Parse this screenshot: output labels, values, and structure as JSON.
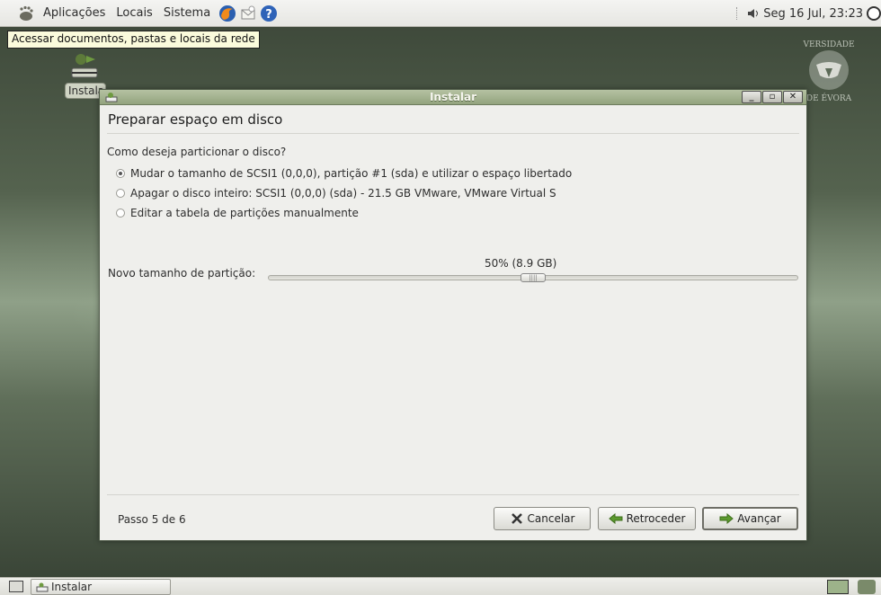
{
  "top_panel": {
    "menus": [
      "Aplicações",
      "Locais",
      "Sistema"
    ],
    "clock": "Seg 16 Jul, 23:23"
  },
  "tooltip": "Acessar documentos, pastas e locais da rede",
  "desktop_icon": {
    "label": "Instalar"
  },
  "window": {
    "title": "Instalar",
    "heading": "Preparar espaço em disco",
    "question": "Como deseja particionar o disco?",
    "options": [
      {
        "label": "Mudar o tamanho de SCSI1 (0,0,0), partição #1 (sda) e utilizar o espaço libertado",
        "selected": true
      },
      {
        "label": "Apagar o disco inteiro: SCSI1 (0,0,0) (sda) - 21.5 GB VMware, VMware Virtual S",
        "selected": false
      },
      {
        "label": "Editar a tabela de partições manualmente",
        "selected": false
      }
    ],
    "partition_size_label": "Novo tamanho de partição:",
    "partition_size_value": "50% (8.9 GB)",
    "partition_size_fraction": 0.5,
    "step": "Passo 5 de 6",
    "buttons": {
      "cancel": "Cancelar",
      "back": "Retroceder",
      "forward": "Avançar"
    }
  },
  "taskbar": {
    "task": "Instalar"
  },
  "colors": {
    "titlebar": "#a3b28f",
    "desktop": "#5d6b58",
    "panel": "#e9e9e5"
  }
}
